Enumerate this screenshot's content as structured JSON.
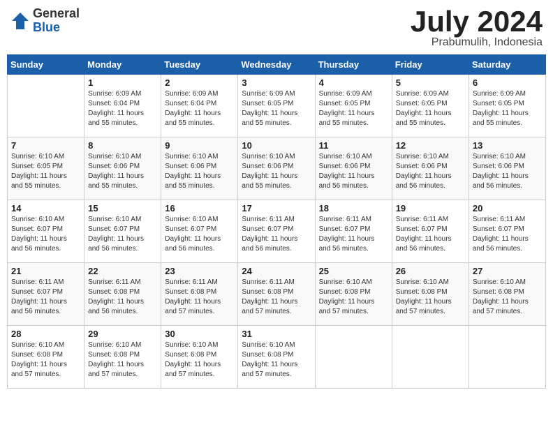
{
  "header": {
    "logo_general": "General",
    "logo_blue": "Blue",
    "month_title": "July 2024",
    "subtitle": "Prabumulih, Indonesia"
  },
  "days_of_week": [
    "Sunday",
    "Monday",
    "Tuesday",
    "Wednesday",
    "Thursday",
    "Friday",
    "Saturday"
  ],
  "weeks": [
    [
      {
        "day": "",
        "info": ""
      },
      {
        "day": "1",
        "info": "Sunrise: 6:09 AM\nSunset: 6:04 PM\nDaylight: 11 hours\nand 55 minutes."
      },
      {
        "day": "2",
        "info": "Sunrise: 6:09 AM\nSunset: 6:04 PM\nDaylight: 11 hours\nand 55 minutes."
      },
      {
        "day": "3",
        "info": "Sunrise: 6:09 AM\nSunset: 6:05 PM\nDaylight: 11 hours\nand 55 minutes."
      },
      {
        "day": "4",
        "info": "Sunrise: 6:09 AM\nSunset: 6:05 PM\nDaylight: 11 hours\nand 55 minutes."
      },
      {
        "day": "5",
        "info": "Sunrise: 6:09 AM\nSunset: 6:05 PM\nDaylight: 11 hours\nand 55 minutes."
      },
      {
        "day": "6",
        "info": "Sunrise: 6:09 AM\nSunset: 6:05 PM\nDaylight: 11 hours\nand 55 minutes."
      }
    ],
    [
      {
        "day": "7",
        "info": "Sunrise: 6:10 AM\nSunset: 6:05 PM\nDaylight: 11 hours\nand 55 minutes."
      },
      {
        "day": "8",
        "info": "Sunrise: 6:10 AM\nSunset: 6:06 PM\nDaylight: 11 hours\nand 55 minutes."
      },
      {
        "day": "9",
        "info": "Sunrise: 6:10 AM\nSunset: 6:06 PM\nDaylight: 11 hours\nand 55 minutes."
      },
      {
        "day": "10",
        "info": "Sunrise: 6:10 AM\nSunset: 6:06 PM\nDaylight: 11 hours\nand 55 minutes."
      },
      {
        "day": "11",
        "info": "Sunrise: 6:10 AM\nSunset: 6:06 PM\nDaylight: 11 hours\nand 56 minutes."
      },
      {
        "day": "12",
        "info": "Sunrise: 6:10 AM\nSunset: 6:06 PM\nDaylight: 11 hours\nand 56 minutes."
      },
      {
        "day": "13",
        "info": "Sunrise: 6:10 AM\nSunset: 6:06 PM\nDaylight: 11 hours\nand 56 minutes."
      }
    ],
    [
      {
        "day": "14",
        "info": "Sunrise: 6:10 AM\nSunset: 6:07 PM\nDaylight: 11 hours\nand 56 minutes."
      },
      {
        "day": "15",
        "info": "Sunrise: 6:10 AM\nSunset: 6:07 PM\nDaylight: 11 hours\nand 56 minutes."
      },
      {
        "day": "16",
        "info": "Sunrise: 6:10 AM\nSunset: 6:07 PM\nDaylight: 11 hours\nand 56 minutes."
      },
      {
        "day": "17",
        "info": "Sunrise: 6:11 AM\nSunset: 6:07 PM\nDaylight: 11 hours\nand 56 minutes."
      },
      {
        "day": "18",
        "info": "Sunrise: 6:11 AM\nSunset: 6:07 PM\nDaylight: 11 hours\nand 56 minutes."
      },
      {
        "day": "19",
        "info": "Sunrise: 6:11 AM\nSunset: 6:07 PM\nDaylight: 11 hours\nand 56 minutes."
      },
      {
        "day": "20",
        "info": "Sunrise: 6:11 AM\nSunset: 6:07 PM\nDaylight: 11 hours\nand 56 minutes."
      }
    ],
    [
      {
        "day": "21",
        "info": "Sunrise: 6:11 AM\nSunset: 6:07 PM\nDaylight: 11 hours\nand 56 minutes."
      },
      {
        "day": "22",
        "info": "Sunrise: 6:11 AM\nSunset: 6:08 PM\nDaylight: 11 hours\nand 56 minutes."
      },
      {
        "day": "23",
        "info": "Sunrise: 6:11 AM\nSunset: 6:08 PM\nDaylight: 11 hours\nand 57 minutes."
      },
      {
        "day": "24",
        "info": "Sunrise: 6:11 AM\nSunset: 6:08 PM\nDaylight: 11 hours\nand 57 minutes."
      },
      {
        "day": "25",
        "info": "Sunrise: 6:10 AM\nSunset: 6:08 PM\nDaylight: 11 hours\nand 57 minutes."
      },
      {
        "day": "26",
        "info": "Sunrise: 6:10 AM\nSunset: 6:08 PM\nDaylight: 11 hours\nand 57 minutes."
      },
      {
        "day": "27",
        "info": "Sunrise: 6:10 AM\nSunset: 6:08 PM\nDaylight: 11 hours\nand 57 minutes."
      }
    ],
    [
      {
        "day": "28",
        "info": "Sunrise: 6:10 AM\nSunset: 6:08 PM\nDaylight: 11 hours\nand 57 minutes."
      },
      {
        "day": "29",
        "info": "Sunrise: 6:10 AM\nSunset: 6:08 PM\nDaylight: 11 hours\nand 57 minutes."
      },
      {
        "day": "30",
        "info": "Sunrise: 6:10 AM\nSunset: 6:08 PM\nDaylight: 11 hours\nand 57 minutes."
      },
      {
        "day": "31",
        "info": "Sunrise: 6:10 AM\nSunset: 6:08 PM\nDaylight: 11 hours\nand 57 minutes."
      },
      {
        "day": "",
        "info": ""
      },
      {
        "day": "",
        "info": ""
      },
      {
        "day": "",
        "info": ""
      }
    ]
  ]
}
